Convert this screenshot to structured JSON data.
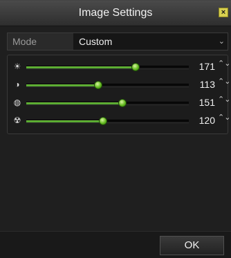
{
  "window": {
    "title": "Image Settings",
    "close_icon": "close-icon",
    "close_glyph": "×"
  },
  "mode": {
    "label": "Mode",
    "value": "Custom",
    "chevron": "⌄"
  },
  "sliders": [
    {
      "icon": "brightness-icon",
      "glyph": "☀",
      "value": 171,
      "display": "171",
      "max": 255
    },
    {
      "icon": "contrast-icon",
      "glyph": "◑",
      "value": 113,
      "display": "113",
      "max": 255
    },
    {
      "icon": "saturation-icon",
      "glyph": "◍",
      "value": 151,
      "display": "151",
      "max": 255
    },
    {
      "icon": "hue-icon",
      "glyph": "☢",
      "value": 120,
      "display": "120",
      "max": 255
    }
  ],
  "spinner_glyph": "⌃⌄",
  "footer": {
    "ok_label": "OK"
  },
  "colors": {
    "accent": "#62b81e",
    "background": "#1f1f1f"
  }
}
